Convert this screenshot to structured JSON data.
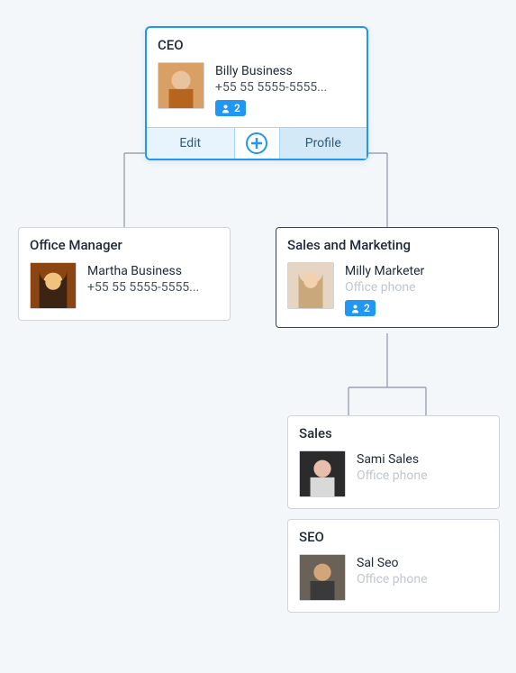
{
  "nodes": {
    "ceo": {
      "title": "CEO",
      "name": "Billy Business",
      "phone": "+55 55 5555-5555...",
      "badge_count": "2"
    },
    "office_manager": {
      "title": "Office Manager",
      "name": "Martha Business",
      "phone": "+55 55 5555-5555..."
    },
    "sales_marketing": {
      "title": "Sales and Marketing",
      "name": "Milly Marketer",
      "phone": "Office phone",
      "badge_count": "2"
    },
    "sales": {
      "title": "Sales",
      "name": "Sami Sales",
      "phone": "Office phone"
    },
    "seo": {
      "title": "SEO",
      "name": "Sal Seo",
      "phone": "Office phone"
    }
  },
  "actions": {
    "edit": "Edit",
    "profile": "Profile"
  }
}
